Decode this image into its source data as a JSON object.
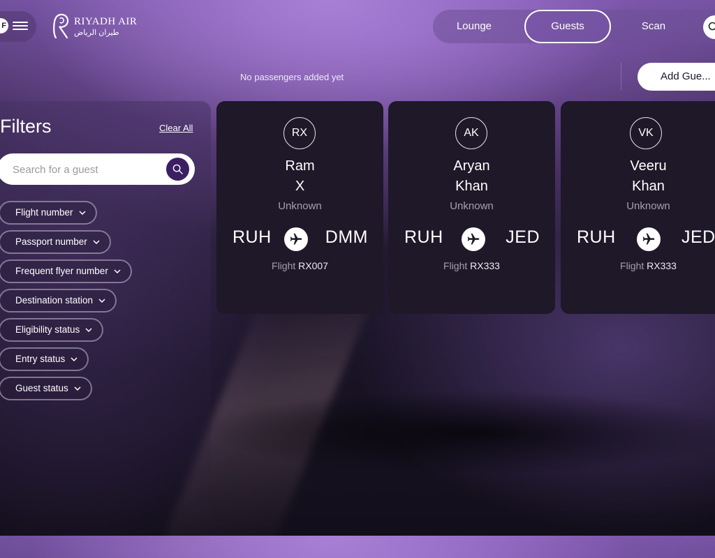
{
  "header": {
    "user_initial": "F",
    "logo_en": "RIYADH AIR",
    "logo_ar": "طيران الرياض",
    "tabs": [
      "Lounge",
      "Guests",
      "Scan"
    ],
    "active_tab": "Guests"
  },
  "status": {
    "no_passengers": "No passengers added yet",
    "add_guest_label": "Add Gue..."
  },
  "filters": {
    "title": "Filters",
    "clear_all": "Clear All",
    "search_placeholder": "Search for a guest",
    "chips": [
      "Flight number",
      "Passport number",
      "Frequent flyer number",
      "Destination station",
      "Eligibility status",
      "Entry status",
      "Guest status"
    ]
  },
  "guests": [
    {
      "initials": "RX",
      "first": "Ram",
      "last": "X",
      "status": "Unknown",
      "from": "RUH",
      "to": "DMM",
      "flight_prefix": "Flight",
      "flight": "RX007"
    },
    {
      "initials": "AK",
      "first": "Aryan",
      "last": "Khan",
      "status": "Unknown",
      "from": "RUH",
      "to": "JED",
      "flight_prefix": "Flight",
      "flight": "RX333"
    },
    {
      "initials": "VK",
      "first": "Veeru",
      "last": "Khan",
      "status": "Unknown",
      "from": "RUH",
      "to": "JED",
      "flight_prefix": "Flight",
      "flight": "RX333"
    }
  ],
  "colors": {
    "accent_purple": "#3b1f62",
    "card_bg": "#1e1829",
    "muted_text": "#a79fb3"
  },
  "icons": [
    "menu-icon",
    "riyadh-air-logo",
    "search-icon",
    "chevron-down-icon",
    "airplane-icon"
  ]
}
